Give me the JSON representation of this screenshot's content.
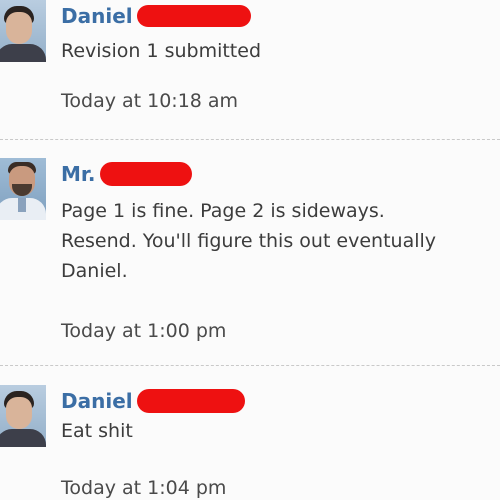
{
  "messages": [
    {
      "sender": "Daniel",
      "body": [
        "Revision 1 submitted"
      ],
      "time": "Today at 10:18 am",
      "avatar": "student-avatar"
    },
    {
      "sender": "Mr.",
      "body": [
        "Page 1 is fine. Page 2 is sideways.",
        "Resend. You'll figure this out eventually",
        "Daniel."
      ],
      "time": "Today at 1:00 pm",
      "avatar": "teacher-avatar"
    },
    {
      "sender": "Daniel",
      "body": [
        "Eat shit"
      ],
      "time": "Today at 1:04 pm",
      "avatar": "student-avatar"
    }
  ],
  "colors": {
    "sender_name": "#3b6ea5",
    "redaction": "#ee1111",
    "body_text": "#3c3c3c",
    "background": "#fbfbfb"
  }
}
